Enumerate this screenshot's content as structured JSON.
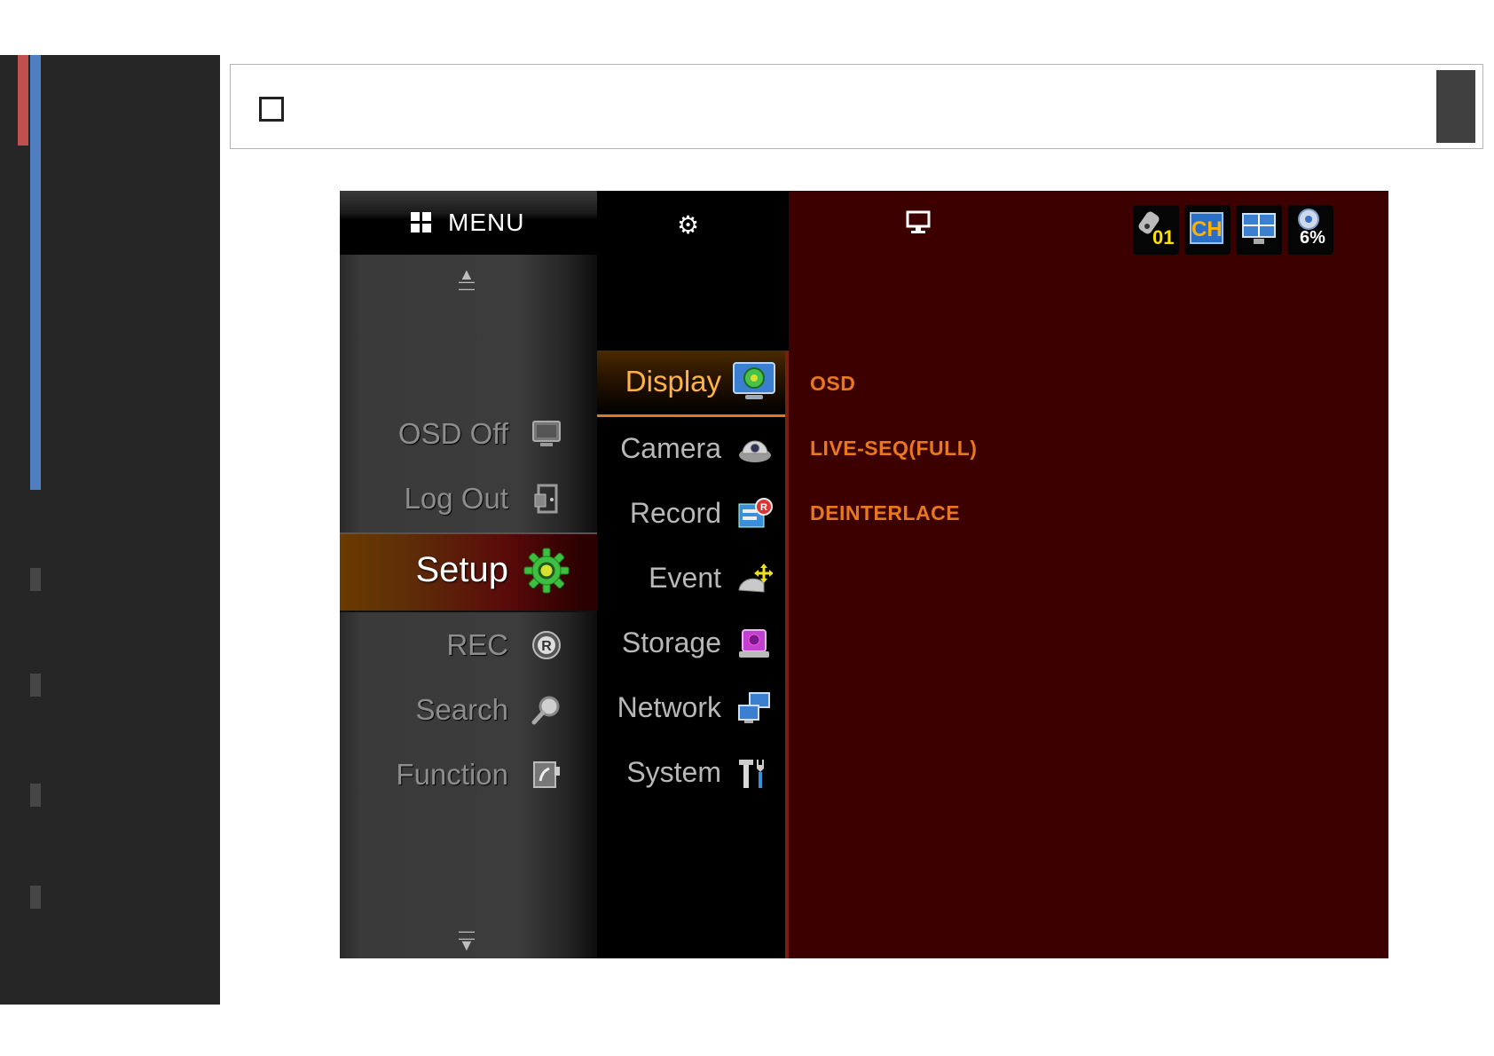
{
  "toolbar": {
    "checkbox_checked": false
  },
  "dvr": {
    "main_menu": {
      "title": "MENU",
      "items": [
        {
          "label": "OSD Off",
          "icon": "monitor-icon"
        },
        {
          "label": "Log Out",
          "icon": "logout-door-icon"
        },
        {
          "label": "Setup",
          "icon": "gear-icon",
          "selected": true
        },
        {
          "label": "REC",
          "icon": "record-r-icon"
        },
        {
          "label": "Search",
          "icon": "magnifier-icon"
        },
        {
          "label": "Function",
          "icon": "function-icon"
        }
      ]
    },
    "setup_menu": {
      "items": [
        {
          "label": "Display",
          "icon": "display-settings-icon",
          "selected": true
        },
        {
          "label": "Camera",
          "icon": "camera-dome-icon"
        },
        {
          "label": "Record",
          "icon": "record-settings-icon"
        },
        {
          "label": "Event",
          "icon": "event-icon"
        },
        {
          "label": "Storage",
          "icon": "storage-icon"
        },
        {
          "label": "Network",
          "icon": "network-icon"
        },
        {
          "label": "System",
          "icon": "system-tools-icon"
        }
      ]
    },
    "display_options": {
      "items": [
        "OSD",
        "LIVE-SEQ(FULL)",
        "DEINTERLACE"
      ]
    },
    "status_icons": {
      "camera_number": "01",
      "channel_label": "CH",
      "disk_usage": "6%"
    },
    "colors": {
      "accent_orange": "#e8781e",
      "selected_label": "#ffb347",
      "detail_bg": "#3c0000",
      "left_red_bar": "#c0504d",
      "left_blue_bar": "#4f7fc1"
    }
  }
}
